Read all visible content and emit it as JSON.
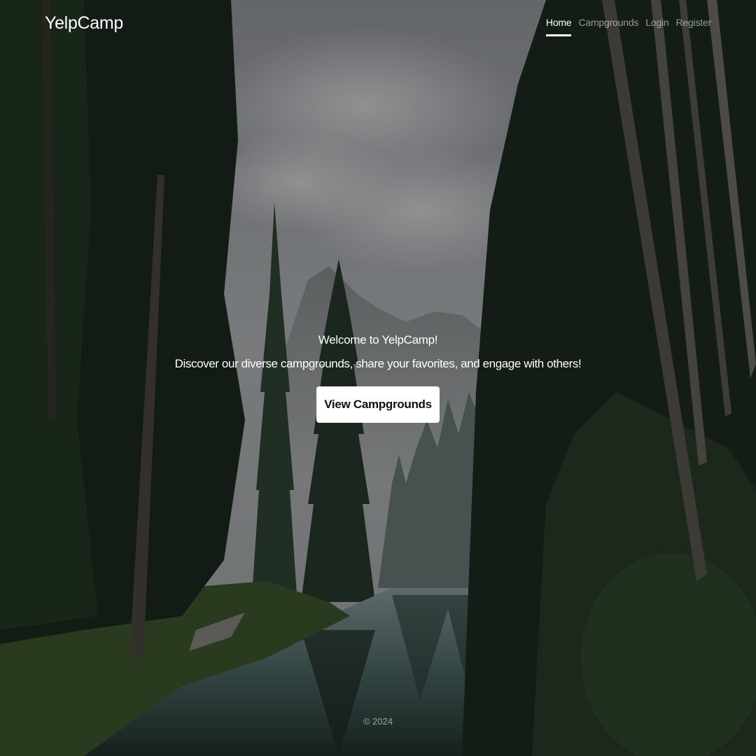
{
  "header": {
    "brand": "YelpCamp",
    "nav": [
      {
        "label": "Home",
        "active": true
      },
      {
        "label": "Campgrounds",
        "active": false
      },
      {
        "label": "Login",
        "active": false
      },
      {
        "label": "Register",
        "active": false
      }
    ]
  },
  "hero": {
    "title": "Welcome to YelpCamp!",
    "lead": "Discover our diverse campgrounds, share your favorites, and engage with others!",
    "button_label": "View Campgrounds"
  },
  "footer": {
    "text": "© 2024"
  },
  "colors": {
    "text": "#ffffff",
    "button_bg": "#ffffff",
    "button_text": "#111111",
    "overlay": "rgba(0,0,0,0.35)"
  }
}
